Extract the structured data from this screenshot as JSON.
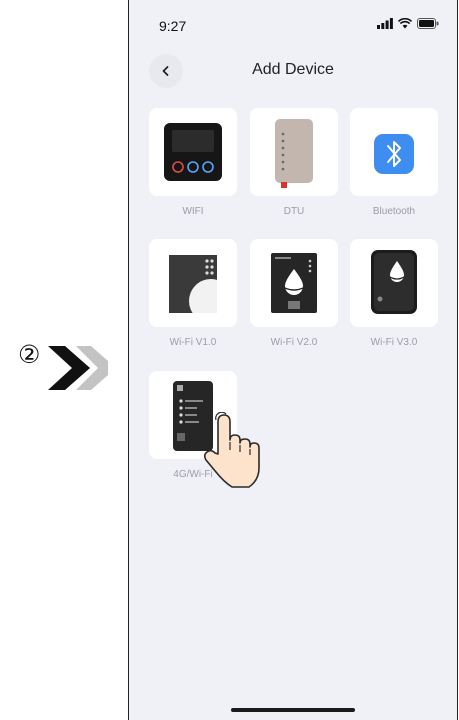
{
  "step": {
    "number": "②"
  },
  "status_bar": {
    "time": "9:27"
  },
  "header": {
    "title": "Add Device"
  },
  "devices": [
    {
      "label": "WIFI",
      "icon": "wifi-controller-icon"
    },
    {
      "label": "DTU",
      "icon": "dtu-module-icon"
    },
    {
      "label": "Bluetooth",
      "icon": "bluetooth-icon"
    },
    {
      "label": "Wi-Fi V1.0",
      "icon": "wifi-v1-device-icon"
    },
    {
      "label": "Wi-Fi V2.0",
      "icon": "wifi-v2-device-icon"
    },
    {
      "label": "Wi-Fi V3.0",
      "icon": "wifi-v3-device-icon"
    },
    {
      "label": "4G/Wi-Fi",
      "icon": "4g-wifi-device-icon"
    }
  ],
  "colors": {
    "background": "#f0f1f6",
    "bluetooth": "#3d8ef0",
    "dtu_accent": "#d9342b"
  }
}
